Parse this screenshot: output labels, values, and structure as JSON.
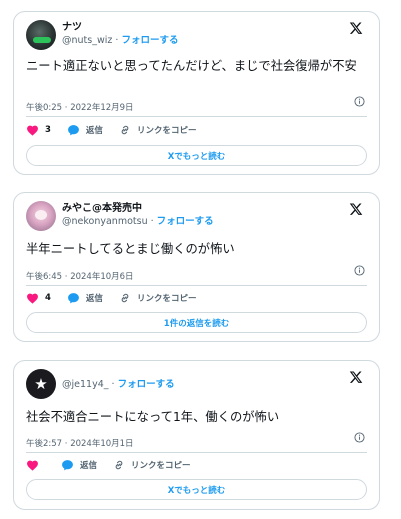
{
  "colors": {
    "accent": "#1d9bf0",
    "like": "#f91880",
    "text": "#0f1419",
    "muted": "#536471",
    "border": "#cfd9de"
  },
  "tweets": [
    {
      "display_name": "ナツ",
      "handle": "@nuts_wiz",
      "separator": " · ",
      "follow_label": "フォローする",
      "text": "ニート適正ないと思ってたんだけど、まじで社会復帰が不安",
      "timestamp": "午後0:25 · 2022年12月9日",
      "likes": "3",
      "reply_label": "返信",
      "copy_link_label": "リンクをコピー",
      "more_button": "Xでもっと読む"
    },
    {
      "display_name": "みやこ@本発売中",
      "handle": "@nekonyanmotsu",
      "separator": " · ",
      "follow_label": "フォローする",
      "text": "半年ニートしてるとまじ働くのが怖い",
      "timestamp": "午後6:45 · 2024年10月6日",
      "likes": "4",
      "reply_label": "返信",
      "copy_link_label": "リンクをコピー",
      "more_button": "1件の返信を読む"
    },
    {
      "display_name": "",
      "handle": "@je11y4_",
      "separator": " · ",
      "follow_label": "フォローする",
      "text": "社会不適合ニートになって1年、働くのが怖い",
      "timestamp": "午後2:57 · 2024年10月1日",
      "likes": "",
      "reply_label": "返信",
      "copy_link_label": "リンクをコピー",
      "more_button": "Xでもっと読む"
    }
  ]
}
